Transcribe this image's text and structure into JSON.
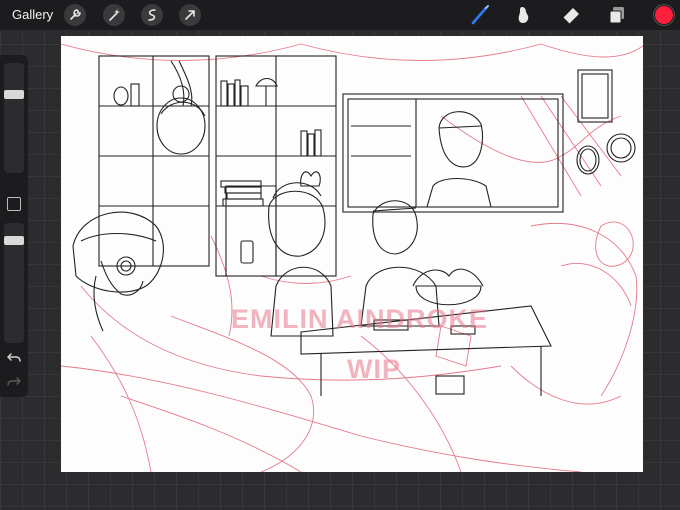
{
  "toolbar": {
    "gallery_label": "Gallery",
    "left_icons": [
      "wrench-icon",
      "magic-wand-icon",
      "selection-icon",
      "transform-arrow-icon"
    ],
    "right_icons": [
      "brush-icon",
      "smudge-icon",
      "eraser-icon",
      "layers-icon"
    ],
    "active_tool": "brush",
    "accent_color": "#2f7bf6",
    "current_color": "#ff1f3d"
  },
  "sidebar": {
    "brush_size_level": 0.27,
    "opacity_level": 0.12
  },
  "canvas": {
    "watermark_line1": "EMILIN AINDROKE",
    "watermark_line2": "WIP",
    "line_color": "#222222",
    "sketch_color": "#e05a6e"
  }
}
